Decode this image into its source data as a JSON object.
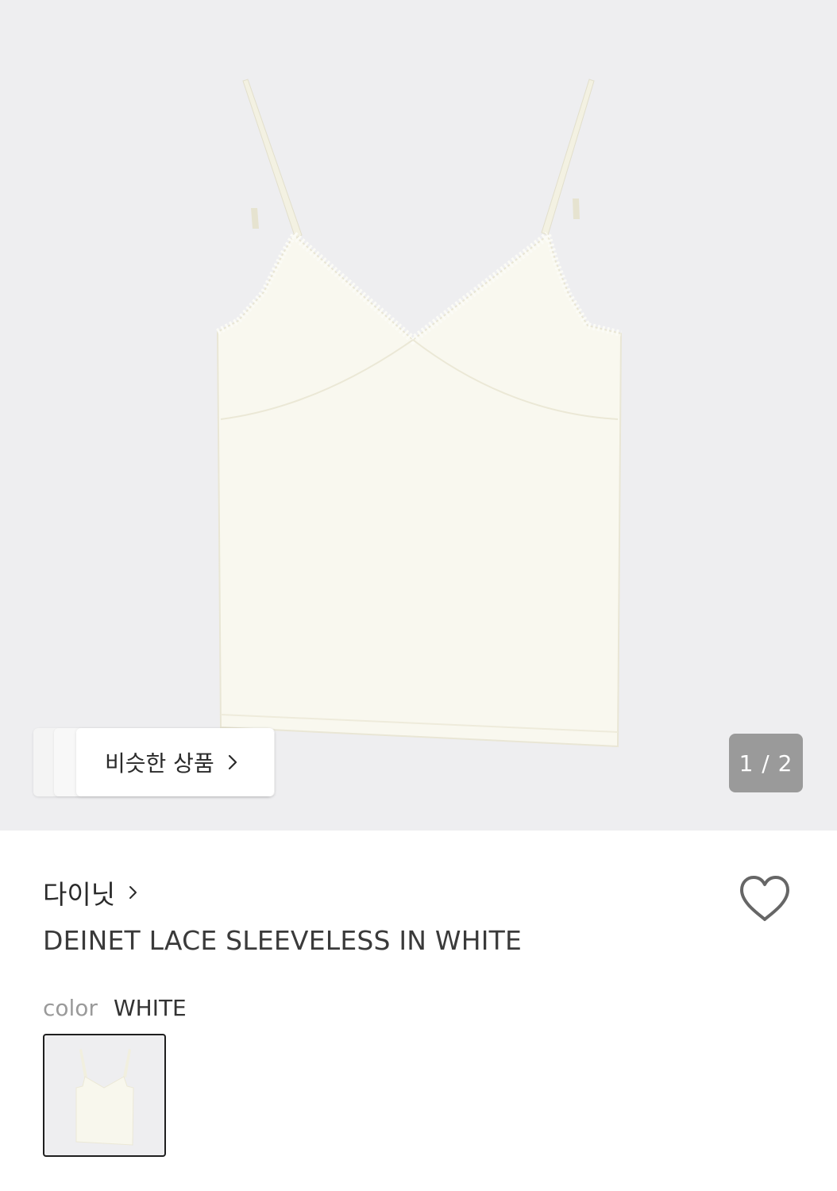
{
  "gallery": {
    "image_subject": "cream camisole top with lace trim",
    "background_color": "#eeeef0",
    "similar_products_label": "비슷한 상품",
    "page_indicator": "1 / 2"
  },
  "product": {
    "brand": "다이닛",
    "name": "DEINET LACE SLEEVELESS IN WHITE",
    "color_label": "color",
    "color_value": "WHITE"
  },
  "icons": {
    "similar_chevron": "chevron-right-icon",
    "brand_chevron": "chevron-right-icon",
    "wishlist": "heart-outline-icon"
  },
  "colors": {
    "text_primary": "#2a2a2a",
    "text_muted": "#9a9a9a",
    "indicator_bg": "#9a9a9a",
    "selected_border": "#1f1f1f"
  }
}
